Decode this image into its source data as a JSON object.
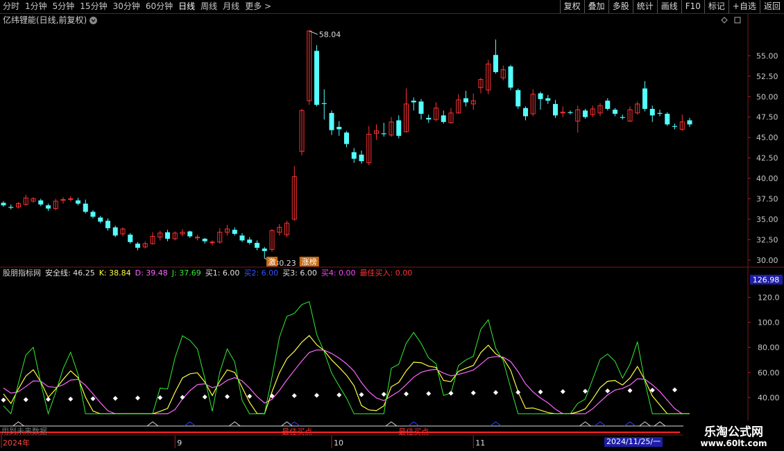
{
  "toolbar": {
    "periods": [
      "分时",
      "1分钟",
      "5分钟",
      "15分钟",
      "30分钟",
      "60分钟",
      "日线",
      "周线",
      "月线",
      "更多 >"
    ],
    "active_period": "日线",
    "buttons": [
      "复权",
      "叠加",
      "多股",
      "统计",
      "画线",
      "F10",
      "标记",
      "+自选",
      "返回"
    ]
  },
  "title": "亿纬锂能(日线,前复权)",
  "price_axis": {
    "labels": [
      "55.00",
      "52.50",
      "50.00",
      "47.50",
      "45.00",
      "42.50",
      "40.00",
      "37.50",
      "35.00",
      "32.50",
      "30.00"
    ],
    "values": [
      55,
      52.5,
      50,
      47.5,
      45,
      42.5,
      40,
      37.5,
      35,
      32.5,
      30
    ],
    "min": 29.3,
    "max": 58.6
  },
  "annotations": {
    "high_label": "58.04",
    "low_label": "30.23",
    "tag_1": "激",
    "tag_2": "涨榜"
  },
  "candles": [
    [
      37.0,
      36.7,
      37.2,
      36.5
    ],
    [
      36.5,
      36.4,
      36.8,
      36.2
    ],
    [
      36.5,
      36.9,
      37.1,
      36.3
    ],
    [
      36.8,
      37.6,
      38.0,
      36.7
    ],
    [
      37.2,
      37.5,
      37.7,
      37.0
    ],
    [
      37.3,
      36.8,
      37.5,
      36.6
    ],
    [
      36.7,
      36.3,
      36.9,
      36.0
    ],
    [
      36.3,
      37.2,
      37.5,
      36.1
    ],
    [
      37.3,
      37.4,
      37.7,
      36.9
    ],
    [
      37.5,
      37.5,
      37.8,
      37.2
    ],
    [
      37.3,
      36.9,
      37.6,
      36.7
    ],
    [
      36.9,
      35.9,
      37.4,
      35.7
    ],
    [
      35.9,
      35.3,
      36.1,
      35.1
    ],
    [
      35.2,
      34.7,
      35.4,
      34.5
    ],
    [
      34.8,
      33.9,
      35.1,
      33.6
    ],
    [
      34.0,
      33.0,
      34.2,
      32.8
    ],
    [
      33.2,
      33.8,
      34.0,
      32.9
    ],
    [
      33.1,
      32.2,
      33.3,
      32.0
    ],
    [
      32.0,
      31.5,
      32.2,
      31.2
    ],
    [
      31.6,
      32.0,
      32.3,
      31.4
    ],
    [
      32.0,
      32.9,
      33.4,
      31.9
    ],
    [
      32.8,
      33.3,
      33.6,
      32.4
    ],
    [
      33.4,
      32.6,
      33.7,
      32.3
    ],
    [
      32.6,
      33.3,
      33.5,
      32.4
    ],
    [
      33.2,
      33.4,
      33.8,
      32.9
    ],
    [
      33.5,
      32.9,
      33.6,
      32.7
    ],
    [
      32.8,
      32.8,
      33.1,
      32.4
    ],
    [
      32.6,
      32.3,
      32.7,
      32.0
    ],
    [
      32.2,
      32.2,
      32.4,
      31.8
    ],
    [
      32.2,
      33.4,
      33.9,
      32.0
    ],
    [
      33.4,
      33.8,
      34.3,
      33.0
    ],
    [
      33.7,
      33.2,
      34.0,
      33.0
    ],
    [
      33.0,
      32.4,
      33.3,
      32.2
    ],
    [
      32.5,
      32.1,
      32.8,
      31.9
    ],
    [
      32.1,
      31.5,
      32.4,
      31.2
    ],
    [
      31.4,
      31.1,
      31.6,
      30.23
    ],
    [
      31.3,
      33.6,
      33.8,
      31.0
    ],
    [
      33.4,
      34.0,
      34.4,
      33.0
    ],
    [
      33.1,
      34.5,
      34.8,
      32.8
    ],
    [
      35.0,
      40.2,
      41.5,
      34.8
    ],
    [
      43.3,
      48.3,
      48.5,
      42.8
    ],
    [
      49.5,
      58.04,
      58.04,
      49.0
    ],
    [
      55.6,
      49.0,
      56.3,
      48.8
    ],
    [
      49.2,
      49.1,
      50.9,
      47.2
    ],
    [
      48.0,
      45.9,
      48.3,
      45.3
    ],
    [
      46.3,
      46.0,
      47.0,
      45.2
    ],
    [
      45.6,
      44.2,
      45.8,
      43.8
    ],
    [
      43.2,
      42.4,
      43.7,
      41.9
    ],
    [
      42.9,
      42.1,
      43.4,
      41.8
    ],
    [
      41.9,
      45.4,
      46.4,
      41.6
    ],
    [
      45.5,
      45.8,
      46.6,
      44.7
    ],
    [
      45.5,
      45.4,
      46.8,
      45.1
    ],
    [
      45.3,
      46.9,
      47.5,
      45.1
    ],
    [
      47.1,
      45.2,
      47.7,
      44.9
    ],
    [
      45.7,
      49.1,
      51.0,
      45.6
    ],
    [
      49.5,
      49.3,
      49.9,
      48.3
    ],
    [
      49.4,
      47.9,
      49.7,
      47.2
    ],
    [
      47.4,
      47.2,
      47.8,
      46.8
    ],
    [
      47.2,
      48.6,
      49.3,
      47.0
    ],
    [
      47.7,
      46.9,
      48.3,
      46.7
    ],
    [
      46.8,
      48.0,
      48.6,
      46.7
    ],
    [
      48.0,
      49.6,
      50.3,
      47.9
    ],
    [
      49.8,
      49.3,
      50.7,
      48.8
    ],
    [
      49.1,
      49.5,
      50.4,
      48.4
    ],
    [
      51.1,
      52.1,
      52.3,
      50.4
    ],
    [
      50.8,
      54.0,
      54.5,
      50.3
    ],
    [
      55.1,
      53.0,
      57.0,
      52.8
    ],
    [
      52.3,
      53.3,
      53.8,
      52.0
    ],
    [
      53.7,
      51.1,
      53.9,
      50.8
    ],
    [
      50.8,
      48.8,
      51.0,
      48.5
    ],
    [
      48.6,
      47.6,
      48.8,
      47.1
    ],
    [
      47.9,
      50.3,
      50.9,
      47.6
    ],
    [
      50.4,
      49.7,
      50.6,
      48.4
    ],
    [
      49.8,
      49.5,
      50.2,
      49.1
    ],
    [
      49.1,
      47.7,
      49.6,
      47.4
    ],
    [
      48.0,
      48.1,
      48.8,
      47.5
    ],
    [
      48.1,
      48.0,
      48.3,
      47.8
    ],
    [
      47.0,
      48.4,
      48.9,
      45.6
    ],
    [
      48.3,
      47.5,
      48.5,
      47.3
    ],
    [
      47.8,
      48.5,
      48.9,
      47.5
    ],
    [
      48.0,
      48.9,
      49.2,
      47.6
    ],
    [
      49.5,
      48.5,
      49.8,
      48.3
    ],
    [
      48.4,
      47.9,
      48.6,
      47.6
    ],
    [
      47.5,
      47.4,
      47.8,
      47.2
    ],
    [
      47.0,
      48.4,
      48.8,
      46.9
    ],
    [
      48.0,
      49.1,
      49.4,
      47.8
    ],
    [
      51.0,
      48.5,
      51.9,
      48.2
    ],
    [
      48.5,
      47.7,
      48.9,
      46.9
    ],
    [
      48.0,
      47.9,
      48.4,
      47.6
    ],
    [
      47.9,
      46.6,
      48.1,
      46.4
    ],
    [
      46.4,
      46.3,
      46.7,
      46.0
    ],
    [
      46.0,
      46.9,
      47.8,
      45.8
    ],
    [
      47.1,
      46.6,
      47.4,
      46.3
    ]
  ],
  "indicator": {
    "name": "股朋指标网",
    "safe_line_label": "安全线: 46.25",
    "k_label": "K: 38.84",
    "d_label": "D: 39.48",
    "j_label": "J: 37.69",
    "buy1_label": "买1: 6.00",
    "buy2_label": "买2: 6.00",
    "buy3_label": "买3: 6.00",
    "buy4_label": "买4: 0.00",
    "best_buy_label": "最佳买入: 0.00",
    "axis_labels": [
      "120.0",
      "100.0",
      "80.00",
      "60.00",
      "40.00"
    ],
    "axis_values": [
      120,
      100,
      80,
      60,
      40
    ],
    "current_value": "126.98",
    "min": 25,
    "max": 133,
    "signal_text": "最佳买点",
    "warning_text": "用到未来数据"
  },
  "dates": {
    "year_label": "2024年",
    "month_labels": [
      "9",
      "10",
      "11"
    ],
    "current_date": "2024/11/25/一"
  },
  "brand": {
    "title": "乐淘公式网",
    "url": "www.60lt.com"
  },
  "colors": {
    "up": "#ff3232",
    "down": "#54ffff",
    "k_line": "#ffffff",
    "d_line": "#ff66ff",
    "j_line": "#33ee33",
    "yellow": "#ffff44",
    "grid": "#5a1010"
  }
}
